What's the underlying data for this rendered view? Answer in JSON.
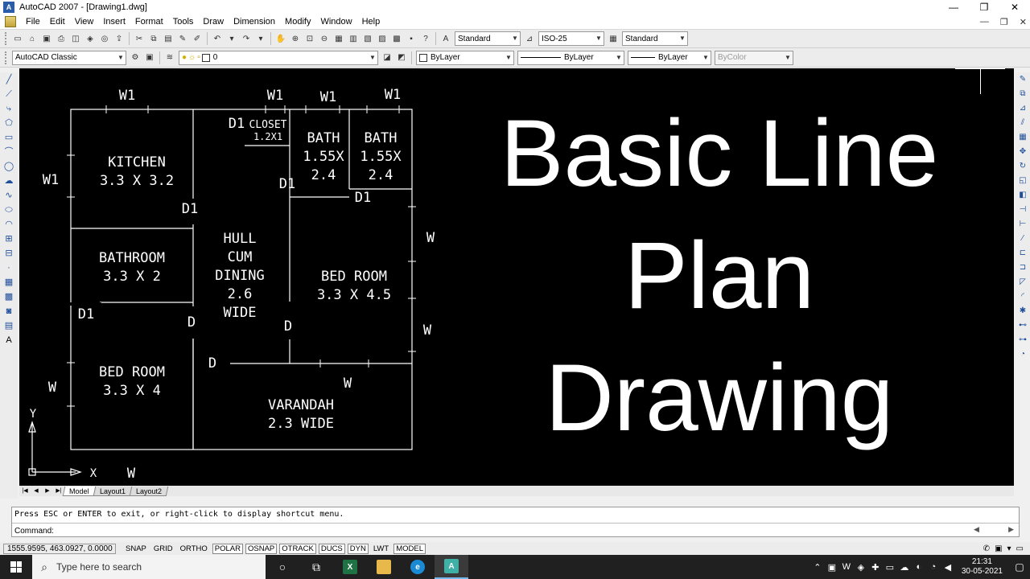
{
  "window": {
    "title": "AutoCAD 2007 - [Drawing1.dwg]",
    "app_icon": "A",
    "minimize": "—",
    "maximize": "❐",
    "close": "✕"
  },
  "menu": {
    "items": [
      "File",
      "Edit",
      "View",
      "Insert",
      "Format",
      "Tools",
      "Draw",
      "Dimension",
      "Modify",
      "Window",
      "Help"
    ],
    "doc_minimize": "—",
    "doc_restore": "❐",
    "doc_close": "✕"
  },
  "toolbar1": {
    "text_style": "Standard",
    "dim_style": "ISO-25",
    "table_style": "Standard"
  },
  "toolbar2": {
    "workspace": "AutoCAD Classic",
    "layer": "0",
    "color": "ByLayer",
    "linetype": "ByLayer",
    "lineweight": "ByLayer",
    "plotstyle": "ByColor"
  },
  "drawing": {
    "labels": {
      "w1_a": "W1",
      "w1_b": "W1",
      "w1_c": "W1",
      "w1_d": "W1",
      "w1_left": "W1",
      "d1_closet": "D1",
      "closet": "CLOSET",
      "closet_size": "1.2X1",
      "bath": "BATH",
      "bath_size1": "1.55X",
      "bath_size2": "2.4",
      "bath2": "BATH",
      "bath2_size1": "1.55X",
      "bath2_size2": "2.4",
      "kitchen": "KITCHEN",
      "kitchen_size": "3.3 X 3.2",
      "d1_a": "D1",
      "d1_b": "D1",
      "d1_c": "D1",
      "d1_d": "D1",
      "hull1": "HULL",
      "hull2": "CUM",
      "hull3": "DINING",
      "hull4": "2.6",
      "hull5": "WIDE",
      "bathroom": "BATHROOM",
      "bathroom_size": "3.3 X 2",
      "bedroom1": "BED ROOM",
      "bedroom1_size": "3.3 X 4.5",
      "bedroom2": "BED ROOM",
      "bedroom2_size": "3.3 X 4",
      "w_right1": "W",
      "w_right2": "W",
      "w_left": "W",
      "w_bottom": "W",
      "w_varandah": "W",
      "d_a": "D",
      "d_b": "D",
      "d_c": "D",
      "varandah": "VARANDAH",
      "varandah_size": "2.3 WIDE",
      "axis_y": "Y",
      "axis_x": "X"
    },
    "title_lines": [
      "Basic Line",
      "Plan",
      "Drawing"
    ]
  },
  "layout_tabs": [
    "Model",
    "Layout1",
    "Layout2"
  ],
  "command": {
    "history": "Press ESC or ENTER to exit, or right-click to display shortcut menu.",
    "prompt": "Command:"
  },
  "status": {
    "coords": "1555.9595, 463.0927, 0.0000",
    "toggles": [
      {
        "label": "SNAP",
        "on": false
      },
      {
        "label": "GRID",
        "on": false
      },
      {
        "label": "ORTHO",
        "on": false
      },
      {
        "label": "POLAR",
        "on": true
      },
      {
        "label": "OSNAP",
        "on": true
      },
      {
        "label": "OTRACK",
        "on": true
      },
      {
        "label": "DUCS",
        "on": true
      },
      {
        "label": "DYN",
        "on": true
      },
      {
        "label": "LWT",
        "on": false
      },
      {
        "label": "MODEL",
        "on": true
      }
    ]
  },
  "taskbar": {
    "search_placeholder": "Type here to search",
    "time": "21:31",
    "date": "30-05-2021"
  },
  "colors": {
    "canvas": "#000000",
    "taskbar": "#202020",
    "accent": "#76b9ed"
  }
}
